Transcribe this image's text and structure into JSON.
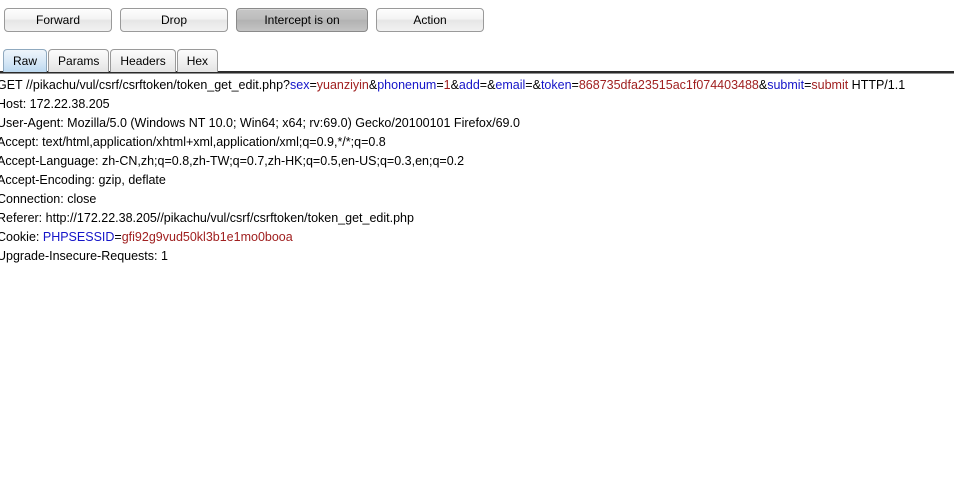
{
  "toolbar": {
    "buttons": [
      {
        "label": "Forward",
        "name": "forward-button",
        "state": "normal"
      },
      {
        "label": "Drop",
        "name": "drop-button",
        "state": "normal"
      },
      {
        "label": "Intercept is on",
        "name": "intercept-toggle-button",
        "state": "toggled"
      },
      {
        "label": "Action",
        "name": "action-button",
        "state": "normal"
      }
    ]
  },
  "tabs": {
    "selected": "Raw",
    "items": [
      {
        "label": "Raw"
      },
      {
        "label": "Params"
      },
      {
        "label": "Headers"
      },
      {
        "label": "Hex"
      }
    ]
  },
  "request": {
    "method": "GET",
    "path": "//pikachu/vul/csrf/csrftoken/token_get_edit.php",
    "protocol": "HTTP/1.1",
    "query_params": [
      {
        "name": "sex",
        "value": "yuanziyin"
      },
      {
        "name": "phonenum",
        "value": "1"
      },
      {
        "name": "add",
        "value": ""
      },
      {
        "name": "email",
        "value": ""
      },
      {
        "name": "token",
        "value": "868735dfa23515ac1f074403488"
      },
      {
        "name": "submit",
        "value": "submit"
      }
    ],
    "request_line_segments": [
      {
        "text": "GET //pikachu/vul/csrf/csrftoken/token_get_edit.php?",
        "kind": "plain"
      },
      {
        "text": "sex",
        "kind": "name"
      },
      {
        "text": "=",
        "kind": "plain"
      },
      {
        "text": "yuanziyin",
        "kind": "value"
      },
      {
        "text": "&",
        "kind": "plain"
      },
      {
        "text": "phonenum",
        "kind": "name"
      },
      {
        "text": "=",
        "kind": "plain"
      },
      {
        "text": "1",
        "kind": "value"
      },
      {
        "text": "&",
        "kind": "plain"
      },
      {
        "text": "add",
        "kind": "name"
      },
      {
        "text": "=&",
        "kind": "plain"
      },
      {
        "text": "email",
        "kind": "name"
      },
      {
        "text": "=&",
        "kind": "plain"
      },
      {
        "text": "token",
        "kind": "name"
      },
      {
        "text": "=",
        "kind": "plain"
      },
      {
        "text": "868735dfa23515ac1f074403488",
        "kind": "value"
      },
      {
        "text": "&",
        "kind": "plain"
      },
      {
        "text": "submit",
        "kind": "name"
      },
      {
        "text": "=",
        "kind": "plain"
      },
      {
        "text": "submit",
        "kind": "value"
      },
      {
        "text": " HTTP/1.1",
        "kind": "plain"
      }
    ],
    "headers": [
      {
        "name": "Host",
        "value": "172.22.38.205"
      },
      {
        "name": "User-Agent",
        "value": "Mozilla/5.0 (Windows NT 10.0; Win64; x64; rv:69.0) Gecko/20100101 Firefox/69.0"
      },
      {
        "name": "Accept",
        "value": "text/html,application/xhtml+xml,application/xml;q=0.9,*/*;q=0.8"
      },
      {
        "name": "Accept-Language",
        "value": "zh-CN,zh;q=0.8,zh-TW;q=0.7,zh-HK;q=0.5,en-US;q=0.3,en;q=0.2"
      },
      {
        "name": "Accept-Encoding",
        "value": "gzip, deflate"
      },
      {
        "name": "Connection",
        "value": "close"
      },
      {
        "name": "Referer",
        "value": "http://172.22.38.205//pikachu/vul/csrf/csrftoken/token_get_edit.php"
      },
      {
        "name": "Upgrade-Insecure-Requests",
        "value": "1"
      }
    ],
    "cookie_line": {
      "label": "Cookie: ",
      "cookie_name": "PHPSESSID",
      "equals": "=",
      "cookie_value": "gfi92g9vud50kl3b1e1mo0booa"
    },
    "line_order": [
      "request-line",
      "Host",
      "User-Agent",
      "Accept",
      "Accept-Language",
      "Accept-Encoding",
      "Connection",
      "Referer",
      "cookie-line",
      "Upgrade-Insecure-Requests"
    ]
  },
  "colors": {
    "param_name": "#1414c8",
    "param_value": "#a02020",
    "selected_tab": "#bcd9f0",
    "toggled_button": "#bdbdbd",
    "text": "#000000",
    "background": "#ffffff"
  }
}
